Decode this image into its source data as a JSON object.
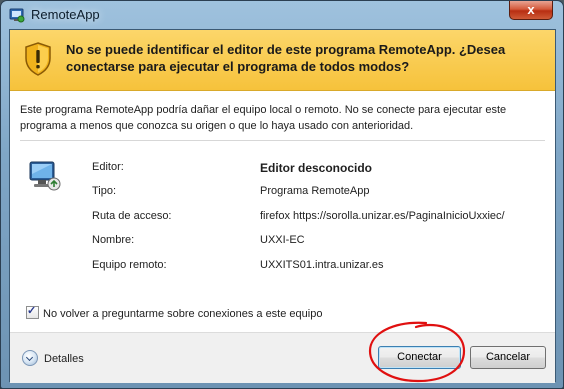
{
  "window": {
    "title": "RemoteApp",
    "close_label": "x"
  },
  "banner": {
    "text": "No se puede identificar el editor de este programa RemoteApp. ¿Desea conectarse para ejecutar el programa de todos modos?"
  },
  "description": "Este programa RemoteApp podría dañar el equipo local o remoto. No se conecte para ejecutar este programa a menos que conozca su origen o que lo haya usado con anterioridad.",
  "details": [
    {
      "label": "Editor:",
      "value": "Editor desconocido"
    },
    {
      "label": "Tipo:",
      "value": "Programa RemoteApp"
    },
    {
      "label": "Ruta de acceso:",
      "value": "firefox https://sorolla.unizar.es/PaginaInicioUxxiec/"
    },
    {
      "label": "Nombre:",
      "value": "UXXI-EC"
    },
    {
      "label": "Equipo remoto:",
      "value": "UXXITS01.intra.unizar.es"
    }
  ],
  "checkbox": {
    "label": "No volver a preguntarme sobre conexiones a este equipo",
    "checked": true
  },
  "footer": {
    "details_label": "Detalles",
    "connect_label": "Conectar",
    "cancel_label": "Cancelar"
  },
  "colors": {
    "banner_bg": "#f6c23b",
    "annotation_red": "#e01010"
  },
  "icons": [
    "remoteapp-icon",
    "warning-shield-icon",
    "remote-computer-icon",
    "chevron-down-icon",
    "close-icon"
  ]
}
